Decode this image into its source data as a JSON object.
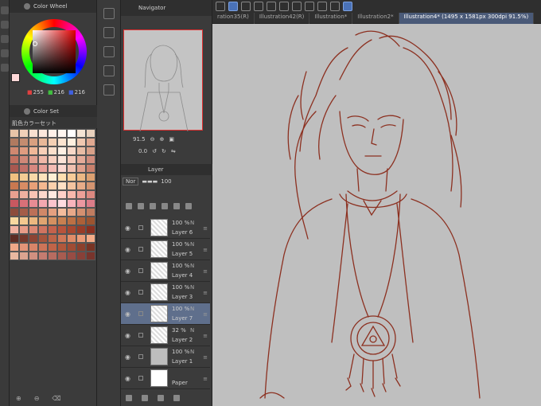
{
  "color_wheel": {
    "tab_label": "Color Wheel",
    "r": "255",
    "g": "216",
    "b": "216"
  },
  "color_set": {
    "tab_label": "Color Set",
    "set_name": "肌色カラーセット",
    "swatches": [
      "#e8c4a8",
      "#f0d0b8",
      "#f8e0d0",
      "#fce8dc",
      "#fff0e8",
      "#fff6f0",
      "#ffffff",
      "#f4e4d4",
      "#e8d0bc",
      "#b07a60",
      "#c48c70",
      "#d8a080",
      "#e8b898",
      "#f4d0b4",
      "#fce4d0",
      "#fff0e0",
      "#f0c8b0",
      "#e0a890",
      "#d08870",
      "#e09c80",
      "#f0b898",
      "#f8d0b8",
      "#fce0cc",
      "#fff0e4",
      "#f8d8c8",
      "#e8bca4",
      "#d8a088",
      "#c07060",
      "#d08878",
      "#e0a090",
      "#f0b8a8",
      "#f8d0c0",
      "#fce4d8",
      "#f4c8b8",
      "#e4aa98",
      "#d08c7c",
      "#a85850",
      "#c07068",
      "#d88880",
      "#e8a098",
      "#f4bcb4",
      "#fcd8d0",
      "#f0c0b0",
      "#e0a08c",
      "#c8806c",
      "#f0c080",
      "#f4cc94",
      "#f8d8a8",
      "#fce4bc",
      "#fff0d4",
      "#ffe0b0",
      "#f8cc98",
      "#ecb884",
      "#dca070",
      "#c87850",
      "#d88c64",
      "#e8a078",
      "#f4b890",
      "#fcd0ac",
      "#ffe0c4",
      "#f4c4a0",
      "#e8ac88",
      "#d49470",
      "#e8a090",
      "#f0b0a0",
      "#f8c4b4",
      "#fcd8cc",
      "#ffe8e0",
      "#ffd0c8",
      "#f8b8ac",
      "#eca098",
      "#dc8880",
      "#c85860",
      "#d87078",
      "#e88c94",
      "#f4a8b0",
      "#fcc4cc",
      "#ffdce0",
      "#f8b4bc",
      "#ec98a0",
      "#dc7c88",
      "#8c4c3c",
      "#a45c48",
      "#bc7058",
      "#d08868",
      "#e4a080",
      "#f4bc9c",
      "#e8a888",
      "#d49070",
      "#c07c60",
      "#f8d8a0",
      "#f4c890",
      "#ecb880",
      "#e0a470",
      "#d49060",
      "#c88050",
      "#bc7044",
      "#ac6038",
      "#9c5430",
      "#f0b0a0",
      "#e89c88",
      "#dc8874",
      "#d07460",
      "#c4624c",
      "#b8543c",
      "#a84830",
      "#983c28",
      "#883020",
      "#5c2c24",
      "#74382c",
      "#8c4434",
      "#a4543c",
      "#bc6448",
      "#d07858",
      "#e08c68",
      "#ec9c78",
      "#f4ac88",
      "#f0a888",
      "#e49478",
      "#d88468",
      "#cc7458",
      "#c06448",
      "#b0583c",
      "#a04c34",
      "#8c402c",
      "#783424",
      "#e8b8a0",
      "#dca490",
      "#d09080",
      "#c47c70",
      "#b86c60",
      "#a85c50",
      "#984c44",
      "#884038",
      "#78342c"
    ]
  },
  "navigator": {
    "tab_label": "Navigator",
    "zoom": "91.5",
    "rotation": "0.0"
  },
  "layer_panel": {
    "tab_label": "Layer",
    "blend_mode": "Nor",
    "opacity": "100",
    "layers": [
      {
        "name": "Layer 6",
        "opacity": "100 %",
        "mode": "N",
        "thumb": "checker",
        "active": false
      },
      {
        "name": "Layer 5",
        "opacity": "100 %",
        "mode": "N",
        "thumb": "checker",
        "active": false
      },
      {
        "name": "Layer 4",
        "opacity": "100 %",
        "mode": "N",
        "thumb": "checker",
        "active": false
      },
      {
        "name": "Layer 3",
        "opacity": "100 %",
        "mode": "N",
        "thumb": "checker",
        "active": false
      },
      {
        "name": "Layer 7",
        "opacity": "100 %",
        "mode": "N",
        "thumb": "checker",
        "active": true
      },
      {
        "name": "Layer 2",
        "opacity": "32 %",
        "mode": "N",
        "thumb": "checker",
        "active": false
      },
      {
        "name": "Layer 1",
        "opacity": "100 %",
        "mode": "N",
        "thumb": "gray",
        "active": false
      },
      {
        "name": "Paper",
        "opacity": "",
        "mode": "",
        "thumb": "white",
        "active": false
      }
    ]
  },
  "tabs": [
    {
      "label": "ration35(R)",
      "active": false
    },
    {
      "label": "Illustration42(R)",
      "active": false
    },
    {
      "label": "Illustration*",
      "active": false
    },
    {
      "label": "Illustration2*",
      "active": false
    },
    {
      "label": "Illustration4* (1495 x 1581px 300dpi 91.5%)",
      "active": true
    }
  ],
  "canvas": {
    "background": "#bfbfbf",
    "stroke": "#8c3020"
  }
}
